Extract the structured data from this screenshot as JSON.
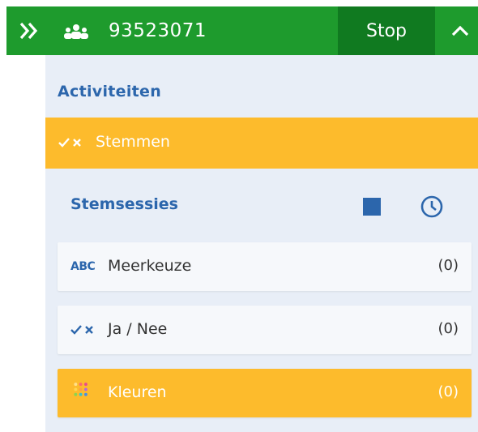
{
  "topbar": {
    "session_id": "93523071",
    "stop_label": "Stop"
  },
  "activities": {
    "title": "Activiteiten",
    "active_item": "Stemmen"
  },
  "sessions": {
    "title": "Stemsessies",
    "items": [
      {
        "icon": "abc-icon",
        "icon_text": "ABC",
        "label": "Meerkeuze",
        "count": "(0)"
      },
      {
        "icon": "check-cross-icon",
        "label": "Ja / Nee",
        "count": "(0)"
      },
      {
        "icon": "color-dots-icon",
        "label": "Kleuren",
        "count": "(0)"
      }
    ]
  },
  "colors": {
    "green": "#1e9b2d",
    "dark_green": "#107a20",
    "blue": "#2c66ac",
    "yellow": "#fdbb2c",
    "panel_bg": "#e8eef7"
  }
}
